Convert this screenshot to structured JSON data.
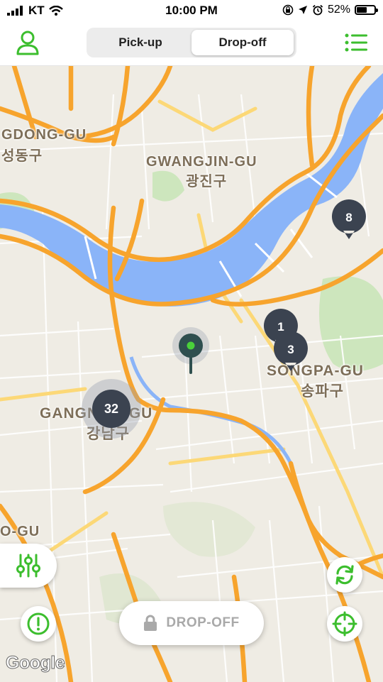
{
  "status_bar": {
    "carrier": "KT",
    "time": "10:00 PM",
    "battery": "52%",
    "battery_level": 0.52
  },
  "header": {
    "tabs": [
      {
        "label": "Pick-up",
        "selected": false
      },
      {
        "label": "Drop-off",
        "selected": true
      }
    ]
  },
  "map": {
    "labels": [
      {
        "text": "GDONG-GU"
      },
      {
        "text": "성동구"
      },
      {
        "text": "GWANGJIN-GU"
      },
      {
        "text": "광진구"
      },
      {
        "text": "SONGPA-GU"
      },
      {
        "text": "송파구"
      },
      {
        "text": "GANGNAM-GU"
      },
      {
        "text": "강남구"
      },
      {
        "text": "O-GU"
      }
    ],
    "clusters": [
      "8",
      "1",
      "3",
      "32"
    ],
    "attribution": "Google"
  },
  "controls": {
    "dropoff_button": "DROP-OFF"
  },
  "colors": {
    "brand_green": "#3cbe2e",
    "cluster": "#3b4350",
    "water": "#8ab4f8",
    "highway": "#f7a42d"
  }
}
